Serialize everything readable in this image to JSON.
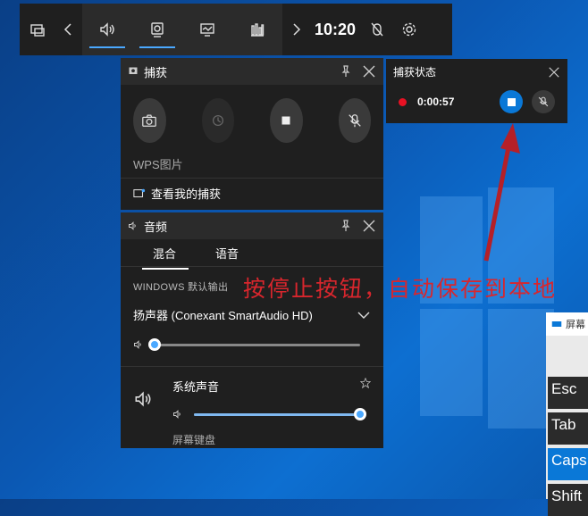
{
  "topbar": {
    "time": "10:20"
  },
  "capture_panel": {
    "title": "捕获",
    "caption": "WPS图片",
    "see_captures": "查看我的捕获"
  },
  "status_panel": {
    "title": "捕获状态",
    "timer": "0:00:57"
  },
  "audio_panel": {
    "title": "音频",
    "tabs": [
      {
        "label": "混合"
      },
      {
        "label": "语音"
      }
    ],
    "section_label": "WINDOWS 默认输出",
    "device": "扬声器 (Conexant SmartAudio HD)",
    "master_volume": 0.0,
    "system_sounds_label": "系统声音",
    "system_volume": 1.0,
    "next_item": "屏幕键盘"
  },
  "annotation": "按停止按钮，自动保存到本地",
  "keyboard": {
    "title": "屏幕",
    "keys": [
      {
        "label": "Esc"
      },
      {
        "label": "Tab"
      },
      {
        "label": "Caps"
      },
      {
        "label": "Shift"
      }
    ]
  },
  "colors": {
    "accent": "#0a78d7",
    "recording": "#e81123",
    "annotation": "#d8262d"
  }
}
